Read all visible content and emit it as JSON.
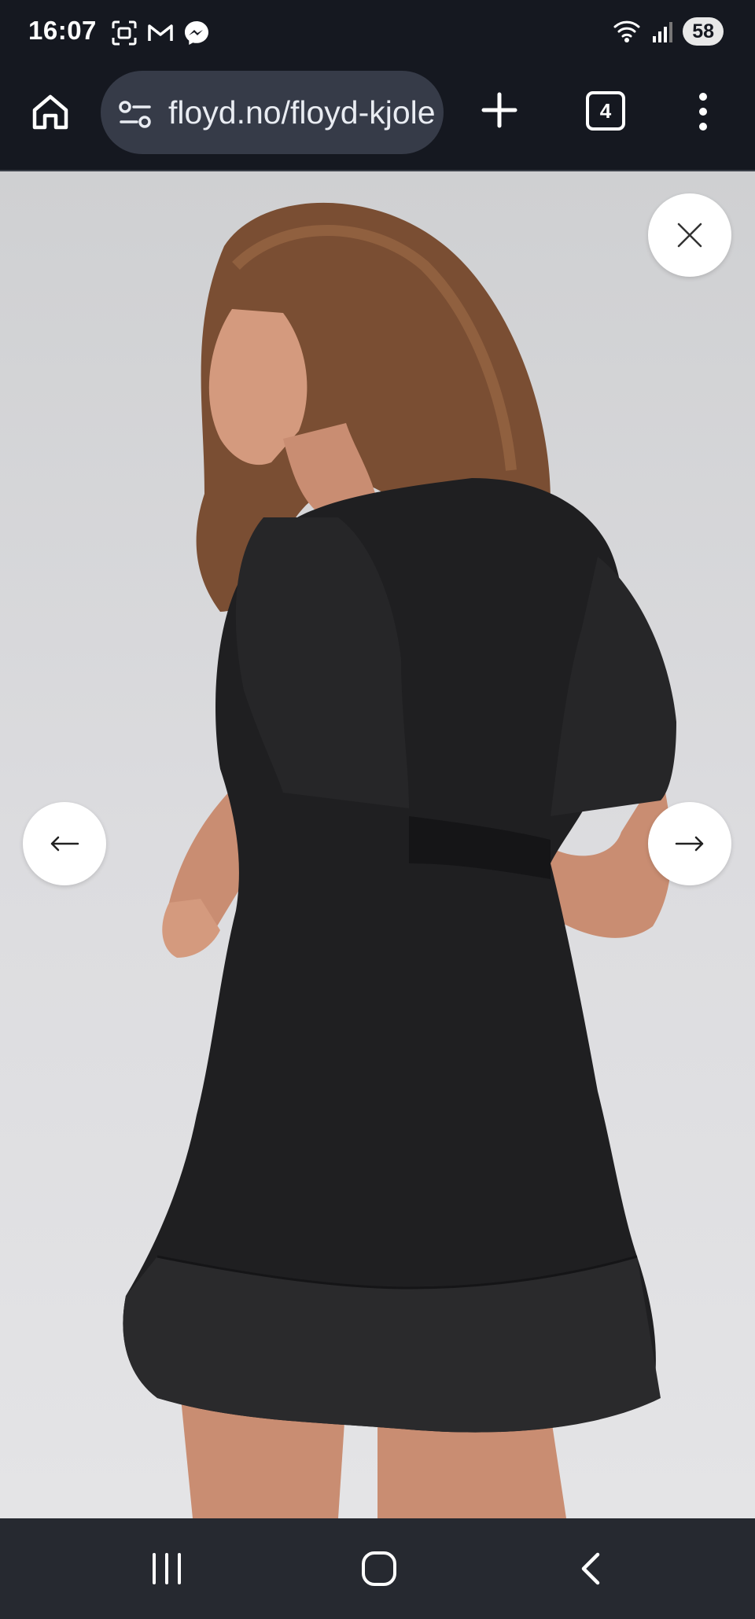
{
  "status_bar": {
    "time": "16:07",
    "battery": "58",
    "icons": [
      "screenshot-icon",
      "gmail-icon",
      "messenger-icon",
      "wifi-icon",
      "signal-icon"
    ]
  },
  "browser": {
    "url": "floyd.no/floyd-kjole",
    "tab_count": "4",
    "icons": [
      "home-icon",
      "site-settings-icon",
      "plus-icon",
      "menu-icon"
    ]
  },
  "gallery": {
    "image": "product-photo-black-dress-back-view",
    "controls": [
      "close-icon",
      "arrow-left-icon",
      "arrow-right-icon"
    ]
  },
  "nav_bar": {
    "icons": [
      "recent-apps-icon",
      "home-circle-icon",
      "back-icon"
    ]
  },
  "colors": {
    "system_bar": "#151820",
    "url_pill": "#363b48",
    "nav_bar": "#262930",
    "background": "#dcdcdf",
    "dress": "#1f1f21"
  }
}
